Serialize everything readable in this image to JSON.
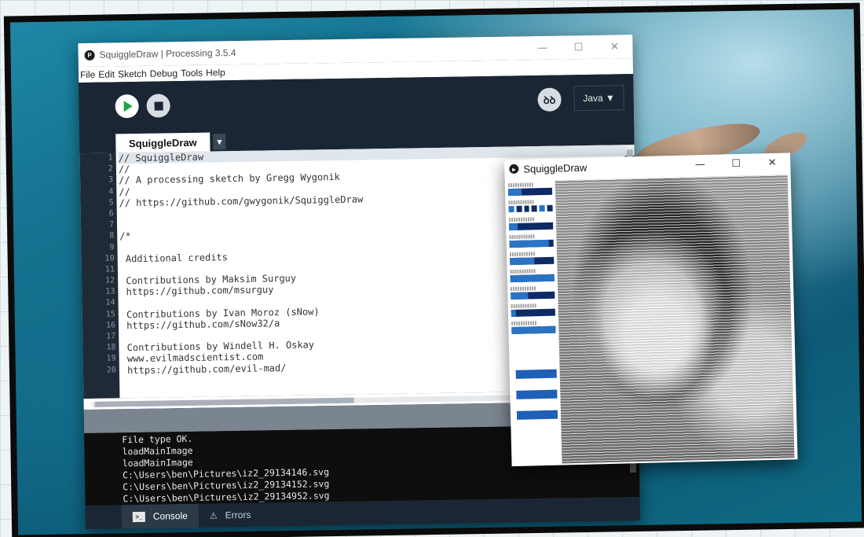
{
  "ide": {
    "title": "SquiggleDraw | Processing 3.5.4",
    "window_controls": [
      "—",
      "☐",
      "✕"
    ],
    "menu": [
      "File",
      "Edit",
      "Sketch",
      "Debug",
      "Tools",
      "Help"
    ],
    "debug_icon_label": "ꝺꝺ",
    "mode": "Java ▼",
    "tab_name": "SquiggleDraw",
    "tab_menu_glyph": "▼",
    "line_numbers": [
      "1",
      "2",
      "3",
      "4",
      "5",
      "6",
      "7",
      "8",
      "9",
      "10",
      "11",
      "12",
      "13",
      "14",
      "15",
      "16",
      "17",
      "18",
      "19",
      "20"
    ],
    "code_lines": [
      "// SquiggleDraw",
      "//",
      "// A processing sketch by Gregg Wygonik",
      "//",
      "// https://github.com/gwygonik/SquiggleDraw",
      "",
      "",
      "/*",
      "",
      " Additional credits",
      "",
      " Contributions by Maksim Surguy",
      " https://github.com/msurguy",
      "",
      " Contributions by Ivan Moroz (sNow)",
      " https://github.com/sNow32/a",
      "",
      " Contributions by Windell H. Oskay",
      " www.evilmadscientist.com",
      " https://github.com/evil-mad/"
    ],
    "console_lines": [
      "File type OK.",
      "loadMainImage",
      "loadMainImage",
      "C:\\Users\\ben\\Pictures\\iz2_29134146.svg",
      "C:\\Users\\ben\\Pictures\\iz2_29134152.svg",
      "C:\\Users\\ben\\Pictures\\iz2_29134952.svg"
    ],
    "bottom_tabs": [
      {
        "label": "Console",
        "icon": "console-icon"
      },
      {
        "label": "Errors",
        "icon": "warning-icon"
      }
    ]
  },
  "squiggle": {
    "title": "SquiggleDraw",
    "window_controls": [
      "—",
      "☐",
      "✕"
    ],
    "canvas_icon": "portrait-squiggle-image"
  },
  "colors": {
    "ide_bg": "#1e2a36",
    "run_green": "#21a24a",
    "panel_blue": "#0e2a66",
    "slider_blue": "#2b73c4"
  }
}
